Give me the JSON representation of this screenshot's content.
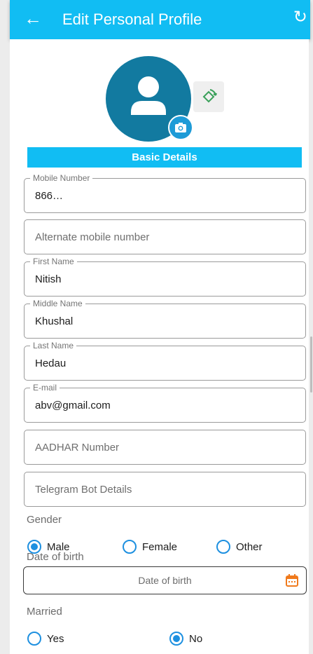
{
  "header": {
    "back_icon": "arrow-left-icon",
    "title": "Edit Personal Profile",
    "refresh_icon": "refresh-icon"
  },
  "profile": {
    "avatar_icon": "person-icon",
    "camera_icon": "camera-icon",
    "rotate_icon": "rotate-icon"
  },
  "section": {
    "title": "Basic Details"
  },
  "fields": {
    "mobile": {
      "label": "Mobile Number",
      "value": "866…"
    },
    "alternate_mobile": {
      "placeholder": "Alternate mobile number"
    },
    "first_name": {
      "label": "First Name",
      "value": "Nitish"
    },
    "middle_name": {
      "label": "Middle Name",
      "value": "Khushal"
    },
    "last_name": {
      "label": "Last Name",
      "value": "Hedau"
    },
    "email": {
      "label": "E-mail",
      "value": "abv@gmail.com"
    },
    "aadhar": {
      "placeholder": "AADHAR Number"
    },
    "telegram": {
      "placeholder": "Telegram Bot Details"
    }
  },
  "gender": {
    "label": "Gender",
    "options": [
      "Male",
      "Female",
      "Other"
    ],
    "selected": "Male"
  },
  "dob": {
    "label": "Date of birth",
    "placeholder": "Date of birth",
    "icon": "calendar-icon"
  },
  "married": {
    "label": "Married",
    "options": [
      "Yes",
      "No"
    ],
    "selected": "No"
  },
  "colors": {
    "primary": "#11bdf3",
    "avatar_bg": "#127aa0",
    "radio": "#1e90e0",
    "calendar": "#f07a1c"
  }
}
